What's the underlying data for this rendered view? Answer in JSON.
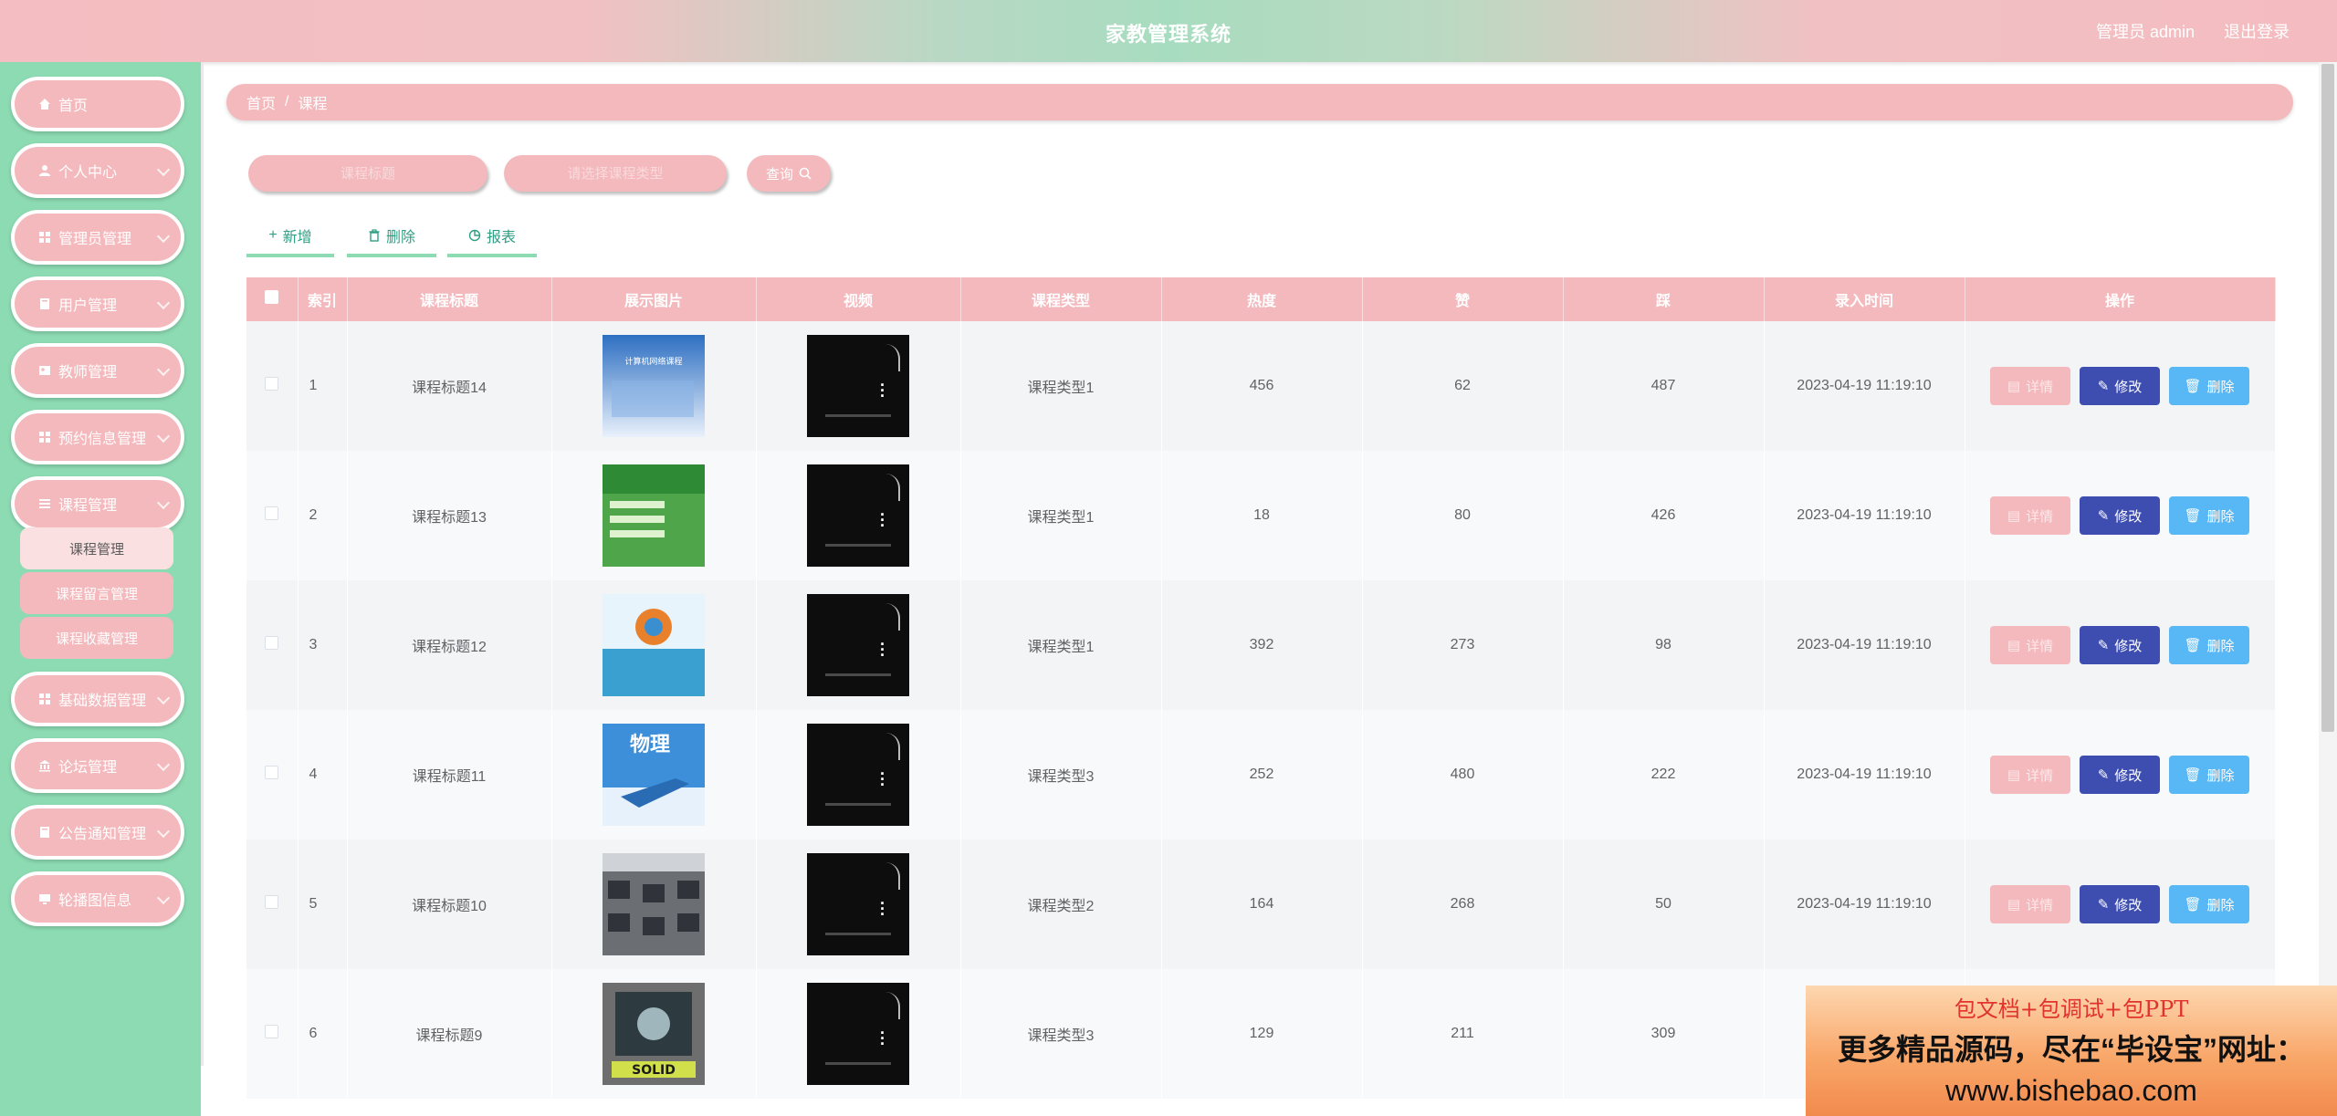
{
  "header": {
    "title": "家教管理系统",
    "user": "管理员 admin",
    "logout": "退出登录"
  },
  "sidebar": {
    "items": [
      {
        "label": "首页",
        "icon": "home-icon"
      },
      {
        "label": "个人中心",
        "icon": "user-icon"
      },
      {
        "label": "管理员管理",
        "icon": "grid-icon"
      },
      {
        "label": "用户管理",
        "icon": "book-icon"
      },
      {
        "label": "教师管理",
        "icon": "id-card-icon"
      },
      {
        "label": "预约信息管理",
        "icon": "grid-icon"
      },
      {
        "label": "课程管理",
        "icon": "list-icon"
      },
      {
        "label": "基础数据管理",
        "icon": "grid-icon"
      },
      {
        "label": "论坛管理",
        "icon": "bank-icon"
      },
      {
        "label": "公告通知管理",
        "icon": "book-icon"
      },
      {
        "label": "轮播图信息",
        "icon": "monitor-icon"
      }
    ],
    "submenu": [
      "课程管理",
      "课程留言管理",
      "课程收藏管理"
    ]
  },
  "breadcrumb": {
    "home": "首页",
    "sep": "/",
    "current": "课程"
  },
  "search": {
    "title_placeholder": "课程标题",
    "type_placeholder": "请选择课程类型",
    "button": "查询"
  },
  "actions": {
    "add": "新增",
    "delete": "删除",
    "report": "报表"
  },
  "table": {
    "headers": [
      "索引",
      "课程标题",
      "展示图片",
      "视频",
      "课程类型",
      "热度",
      "赞",
      "踩",
      "录入时间",
      "操作"
    ],
    "rows": [
      {
        "index": "1",
        "title": "课程标题14",
        "type": "课程类型1",
        "hot": "456",
        "up": "62",
        "down": "487",
        "time": "2023-04-19 11:19:10"
      },
      {
        "index": "2",
        "title": "课程标题13",
        "type": "课程类型1",
        "hot": "18",
        "up": "80",
        "down": "426",
        "time": "2023-04-19 11:19:10"
      },
      {
        "index": "3",
        "title": "课程标题12",
        "type": "课程类型1",
        "hot": "392",
        "up": "273",
        "down": "98",
        "time": "2023-04-19 11:19:10"
      },
      {
        "index": "4",
        "title": "课程标题11",
        "type": "课程类型3",
        "hot": "252",
        "up": "480",
        "down": "222",
        "time": "2023-04-19 11:19:10"
      },
      {
        "index": "5",
        "title": "课程标题10",
        "type": "课程类型2",
        "hot": "164",
        "up": "268",
        "down": "50",
        "time": "2023-04-19 11:19:10"
      },
      {
        "index": "6",
        "title": "课程标题9",
        "type": "课程类型3",
        "hot": "129",
        "up": "211",
        "down": "309",
        "time": "2"
      }
    ],
    "row_actions": {
      "detail": "详情",
      "edit": "修改",
      "delete": "删除"
    }
  },
  "thumb_texts": {
    "t1": "计算机网络课程",
    "t3_brand": "物理",
    "t6": "SOLID"
  },
  "ad": {
    "line1": "包文档+包调试+包PPT",
    "line2": "更多精品源码，尽在“毕设宝”网址：",
    "line3": "www.bishebao.com"
  },
  "colors": {
    "pink": "#f4b9bd",
    "green": "#8ddbb3",
    "edit": "#3d4db0",
    "delete": "#57b8f5"
  }
}
